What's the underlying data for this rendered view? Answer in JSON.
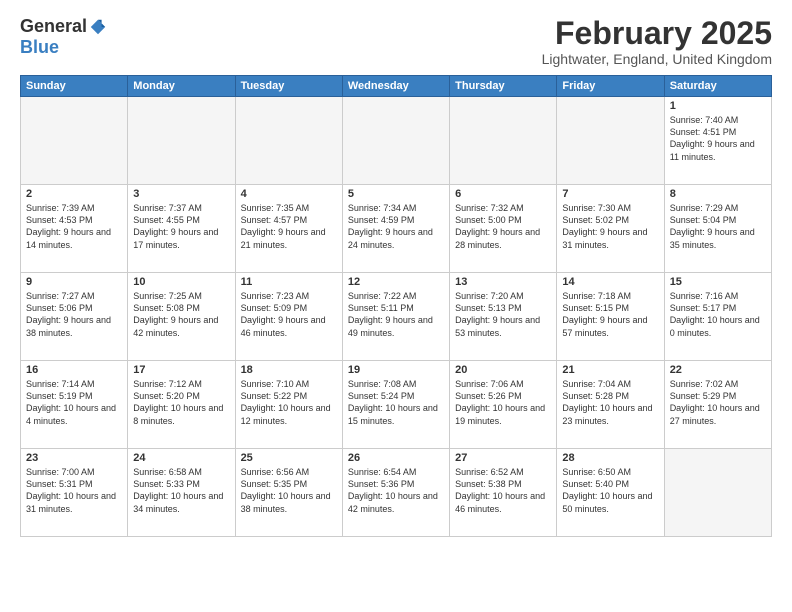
{
  "header": {
    "logo_general": "General",
    "logo_blue": "Blue",
    "month": "February 2025",
    "location": "Lightwater, England, United Kingdom"
  },
  "weekdays": [
    "Sunday",
    "Monday",
    "Tuesday",
    "Wednesday",
    "Thursday",
    "Friday",
    "Saturday"
  ],
  "weeks": [
    [
      {
        "day": "",
        "empty": true
      },
      {
        "day": "",
        "empty": true
      },
      {
        "day": "",
        "empty": true
      },
      {
        "day": "",
        "empty": true
      },
      {
        "day": "",
        "empty": true
      },
      {
        "day": "",
        "empty": true
      },
      {
        "day": "1",
        "sunrise": "7:40 AM",
        "sunset": "4:51 PM",
        "daylight": "9 hours and 11 minutes"
      }
    ],
    [
      {
        "day": "2",
        "sunrise": "7:39 AM",
        "sunset": "4:53 PM",
        "daylight": "9 hours and 14 minutes"
      },
      {
        "day": "3",
        "sunrise": "7:37 AM",
        "sunset": "4:55 PM",
        "daylight": "9 hours and 17 minutes"
      },
      {
        "day": "4",
        "sunrise": "7:35 AM",
        "sunset": "4:57 PM",
        "daylight": "9 hours and 21 minutes"
      },
      {
        "day": "5",
        "sunrise": "7:34 AM",
        "sunset": "4:59 PM",
        "daylight": "9 hours and 24 minutes"
      },
      {
        "day": "6",
        "sunrise": "7:32 AM",
        "sunset": "5:00 PM",
        "daylight": "9 hours and 28 minutes"
      },
      {
        "day": "7",
        "sunrise": "7:30 AM",
        "sunset": "5:02 PM",
        "daylight": "9 hours and 31 minutes"
      },
      {
        "day": "8",
        "sunrise": "7:29 AM",
        "sunset": "5:04 PM",
        "daylight": "9 hours and 35 minutes"
      }
    ],
    [
      {
        "day": "9",
        "sunrise": "7:27 AM",
        "sunset": "5:06 PM",
        "daylight": "9 hours and 38 minutes"
      },
      {
        "day": "10",
        "sunrise": "7:25 AM",
        "sunset": "5:08 PM",
        "daylight": "9 hours and 42 minutes"
      },
      {
        "day": "11",
        "sunrise": "7:23 AM",
        "sunset": "5:09 PM",
        "daylight": "9 hours and 46 minutes"
      },
      {
        "day": "12",
        "sunrise": "7:22 AM",
        "sunset": "5:11 PM",
        "daylight": "9 hours and 49 minutes"
      },
      {
        "day": "13",
        "sunrise": "7:20 AM",
        "sunset": "5:13 PM",
        "daylight": "9 hours and 53 minutes"
      },
      {
        "day": "14",
        "sunrise": "7:18 AM",
        "sunset": "5:15 PM",
        "daylight": "9 hours and 57 minutes"
      },
      {
        "day": "15",
        "sunrise": "7:16 AM",
        "sunset": "5:17 PM",
        "daylight": "10 hours and 0 minutes"
      }
    ],
    [
      {
        "day": "16",
        "sunrise": "7:14 AM",
        "sunset": "5:19 PM",
        "daylight": "10 hours and 4 minutes"
      },
      {
        "day": "17",
        "sunrise": "7:12 AM",
        "sunset": "5:20 PM",
        "daylight": "10 hours and 8 minutes"
      },
      {
        "day": "18",
        "sunrise": "7:10 AM",
        "sunset": "5:22 PM",
        "daylight": "10 hours and 12 minutes"
      },
      {
        "day": "19",
        "sunrise": "7:08 AM",
        "sunset": "5:24 PM",
        "daylight": "10 hours and 15 minutes"
      },
      {
        "day": "20",
        "sunrise": "7:06 AM",
        "sunset": "5:26 PM",
        "daylight": "10 hours and 19 minutes"
      },
      {
        "day": "21",
        "sunrise": "7:04 AM",
        "sunset": "5:28 PM",
        "daylight": "10 hours and 23 minutes"
      },
      {
        "day": "22",
        "sunrise": "7:02 AM",
        "sunset": "5:29 PM",
        "daylight": "10 hours and 27 minutes"
      }
    ],
    [
      {
        "day": "23",
        "sunrise": "7:00 AM",
        "sunset": "5:31 PM",
        "daylight": "10 hours and 31 minutes"
      },
      {
        "day": "24",
        "sunrise": "6:58 AM",
        "sunset": "5:33 PM",
        "daylight": "10 hours and 34 minutes"
      },
      {
        "day": "25",
        "sunrise": "6:56 AM",
        "sunset": "5:35 PM",
        "daylight": "10 hours and 38 minutes"
      },
      {
        "day": "26",
        "sunrise": "6:54 AM",
        "sunset": "5:36 PM",
        "daylight": "10 hours and 42 minutes"
      },
      {
        "day": "27",
        "sunrise": "6:52 AM",
        "sunset": "5:38 PM",
        "daylight": "10 hours and 46 minutes"
      },
      {
        "day": "28",
        "sunrise": "6:50 AM",
        "sunset": "5:40 PM",
        "daylight": "10 hours and 50 minutes"
      },
      {
        "day": "",
        "empty": true
      }
    ]
  ]
}
